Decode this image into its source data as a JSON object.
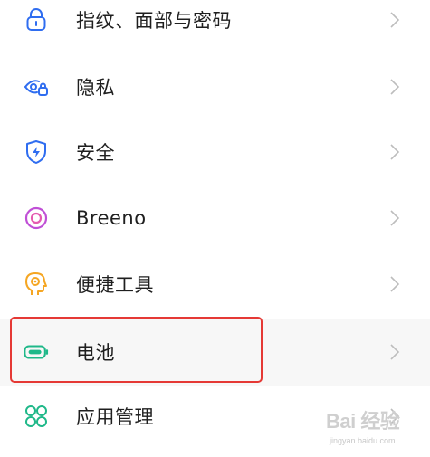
{
  "settings": {
    "items": [
      {
        "label": "指纹、面部与密码",
        "icon": "lock-icon",
        "icon_color": "#2f6df0"
      },
      {
        "label": "隐私",
        "icon": "eye-lock-icon",
        "icon_color": "#2f6df0"
      },
      {
        "label": "安全",
        "icon": "shield-bolt-icon",
        "icon_color": "#2f6df0"
      },
      {
        "label": "Breeno",
        "icon": "breeno-ring-icon",
        "icon_color": "#c04fd6"
      },
      {
        "label": "便捷工具",
        "icon": "head-gear-icon",
        "icon_color": "#f5a623"
      },
      {
        "label": "电池",
        "icon": "battery-icon",
        "icon_color": "#1fb889"
      },
      {
        "label": "应用管理",
        "icon": "app-grid-icon",
        "icon_color": "#1fb889"
      }
    ]
  },
  "colors": {
    "text": "#1f1f1f",
    "chevron": "#bdbdbd",
    "highlight_border": "#e53935"
  },
  "watermark": {
    "logo": "Bai 经验",
    "sub": "jingyan.baidu.com"
  }
}
